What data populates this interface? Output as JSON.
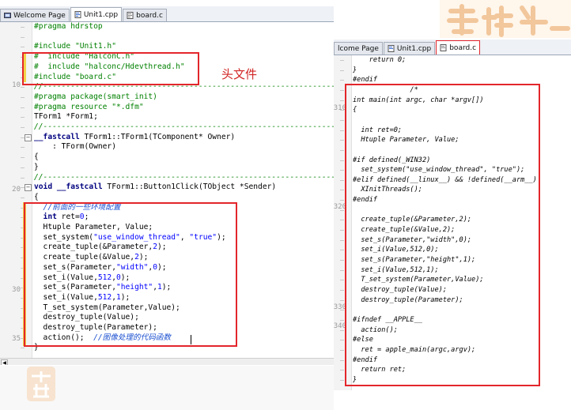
{
  "left": {
    "tabs": [
      {
        "label": "Welcome Page",
        "icon": "welcome-page-icon"
      },
      {
        "label": "Unit1.cpp",
        "icon": "cpp-file-icon"
      },
      {
        "label": "board.c",
        "icon": "c-file-icon"
      }
    ],
    "line_numbers": [
      "10",
      "20",
      "30",
      "35"
    ],
    "annotation": "头文件",
    "lines": [
      [
        [
          "#pragma hdrstop",
          "pp"
        ]
      ],
      [],
      [
        [
          "#include \"Unit1.h\"",
          "pp"
        ]
      ],
      [
        [
          "#  include \"HalconC.h\"",
          "pp"
        ]
      ],
      [
        [
          "#  include \"halconc/Hdevthread.h\"",
          "pp"
        ]
      ],
      [
        [
          "#include \"board.c\"",
          "pp"
        ]
      ],
      [
        [
          "//---------------------------------------------------------------------------",
          "cm"
        ]
      ],
      [
        [
          "#pragma package(smart_init)",
          "pp"
        ]
      ],
      [
        [
          "#pragma resource \"*.dfm\"",
          "pp"
        ]
      ],
      [
        [
          "TForm1 *Form1;",
          ""
        ]
      ],
      [
        [
          "//---------------------------------------------------------------------------",
          "cm"
        ]
      ],
      [
        [
          "__fastcall",
          "kw"
        ],
        [
          " TForm1::TForm1(TComponent* Owner)",
          ""
        ]
      ],
      [
        [
          "    : TForm(Owner)",
          ""
        ]
      ],
      [
        [
          "{",
          ""
        ]
      ],
      [
        [
          "}",
          ""
        ]
      ],
      [
        [
          "//---------------------------------------------------------------------------",
          "cm"
        ]
      ],
      [
        [
          "void",
          "kw"
        ],
        [
          " ",
          ""
        ],
        [
          "__fastcall",
          "kw"
        ],
        [
          " TForm1::Button1Click(TObject *Sender)",
          ""
        ]
      ],
      [
        [
          "{",
          ""
        ]
      ],
      [
        [
          "  //前面的一些环境配置",
          "cmb"
        ]
      ],
      [
        [
          "  int",
          "kw"
        ],
        [
          " ret=",
          ""
        ],
        [
          "0",
          "nm"
        ],
        [
          ";",
          ""
        ]
      ],
      [
        [
          "  Htuple Parameter, Value;",
          ""
        ]
      ],
      [
        [
          "  set_system(",
          ""
        ],
        [
          "\"use_window_thread\"",
          "st"
        ],
        [
          ", ",
          ""
        ],
        [
          "\"true\"",
          "st"
        ],
        [
          ");",
          ""
        ]
      ],
      [
        [
          "  create_tuple(&Parameter,",
          ""
        ],
        [
          "2",
          "nm"
        ],
        [
          ");",
          ""
        ]
      ],
      [
        [
          "  create_tuple(&Value,",
          ""
        ],
        [
          "2",
          "nm"
        ],
        [
          ");",
          ""
        ]
      ],
      [
        [
          "  set_s(Parameter,",
          ""
        ],
        [
          "\"width\"",
          "st"
        ],
        [
          ",",
          ""
        ],
        [
          "0",
          "nm"
        ],
        [
          ");",
          ""
        ]
      ],
      [
        [
          "  set_i(Value,",
          ""
        ],
        [
          "512",
          "nm"
        ],
        [
          ",",
          ""
        ],
        [
          "0",
          "nm"
        ],
        [
          ");",
          ""
        ]
      ],
      [
        [
          "  set_s(Parameter,",
          ""
        ],
        [
          "\"height\"",
          "st"
        ],
        [
          ",",
          ""
        ],
        [
          "1",
          "nm"
        ],
        [
          ");",
          ""
        ]
      ],
      [
        [
          "  set_i(Value,",
          ""
        ],
        [
          "512",
          "nm"
        ],
        [
          ",",
          ""
        ],
        [
          "1",
          "nm"
        ],
        [
          ");",
          ""
        ]
      ],
      [
        [
          "  T_set_system(Parameter,Value);",
          ""
        ]
      ],
      [
        [
          "  destroy_tuple(Value);",
          ""
        ]
      ],
      [
        [
          "  destroy_tuple(Parameter);",
          ""
        ]
      ],
      [
        [
          "  action();  ",
          ""
        ],
        [
          "//图像处理的代码函数",
          "cmb"
        ]
      ],
      [
        [
          "}",
          ""
        ]
      ]
    ]
  },
  "right": {
    "tabs": [
      {
        "label": "lcome Page",
        "icon": "welcome-page-icon"
      },
      {
        "label": "Unit1.cpp",
        "icon": "cpp-file-icon"
      },
      {
        "label": "board.c",
        "icon": "c-file-icon"
      }
    ],
    "line_numbers": [
      "310",
      "320",
      "330",
      "340"
    ],
    "lines": [
      [
        [
          "    return 0;",
          ""
        ]
      ],
      [
        [
          "}",
          ""
        ]
      ],
      [
        [
          "#endif",
          ""
        ]
      ],
      [
        [
          "              /*",
          ""
        ]
      ],
      [
        [
          "int main(int argc, char *argv[])",
          ""
        ]
      ],
      [
        [
          "{",
          ""
        ]
      ],
      [],
      [
        [
          "  int ret=0;",
          ""
        ]
      ],
      [
        [
          "  Htuple Parameter, Value;",
          ""
        ]
      ],
      [],
      [
        [
          "#if defined(_WIN32)",
          ""
        ]
      ],
      [
        [
          "  set_system(\"use_window_thread\", \"true\");",
          ""
        ]
      ],
      [
        [
          "#elif defined(__linux__) && !defined(__arm__)",
          ""
        ]
      ],
      [
        [
          "  XInitThreads();",
          ""
        ]
      ],
      [
        [
          "#endif",
          ""
        ]
      ],
      [],
      [
        [
          "  create_tuple(&Parameter,2);",
          ""
        ]
      ],
      [
        [
          "  create_tuple(&Value,2);",
          ""
        ]
      ],
      [
        [
          "  set_s(Parameter,\"width\",0);",
          ""
        ]
      ],
      [
        [
          "  set_i(Value,512,0);",
          ""
        ]
      ],
      [
        [
          "  set_s(Parameter,\"height\",1);",
          ""
        ]
      ],
      [
        [
          "  set_i(Value,512,1);",
          ""
        ]
      ],
      [
        [
          "  T_set_system(Parameter,Value);",
          ""
        ]
      ],
      [
        [
          "  destroy_tuple(Value);",
          ""
        ]
      ],
      [
        [
          "  destroy_tuple(Parameter);",
          ""
        ]
      ],
      [],
      [
        [
          "#ifndef __APPLE__",
          ""
        ]
      ],
      [
        [
          "  action();",
          ""
        ]
      ],
      [
        [
          "#else",
          ""
        ]
      ],
      [
        [
          "  ret = apple_main(argc,argv);",
          ""
        ]
      ],
      [
        [
          "#endif",
          ""
        ]
      ],
      [
        [
          "  return ret;",
          ""
        ]
      ],
      [
        [
          "}",
          ""
        ]
      ]
    ]
  },
  "colors": {
    "annotation_box": "#e3262b",
    "preprocessor": "#008000",
    "keyword": "#000080",
    "string": "#0000ff",
    "modified_marker": "#f2d44a"
  }
}
